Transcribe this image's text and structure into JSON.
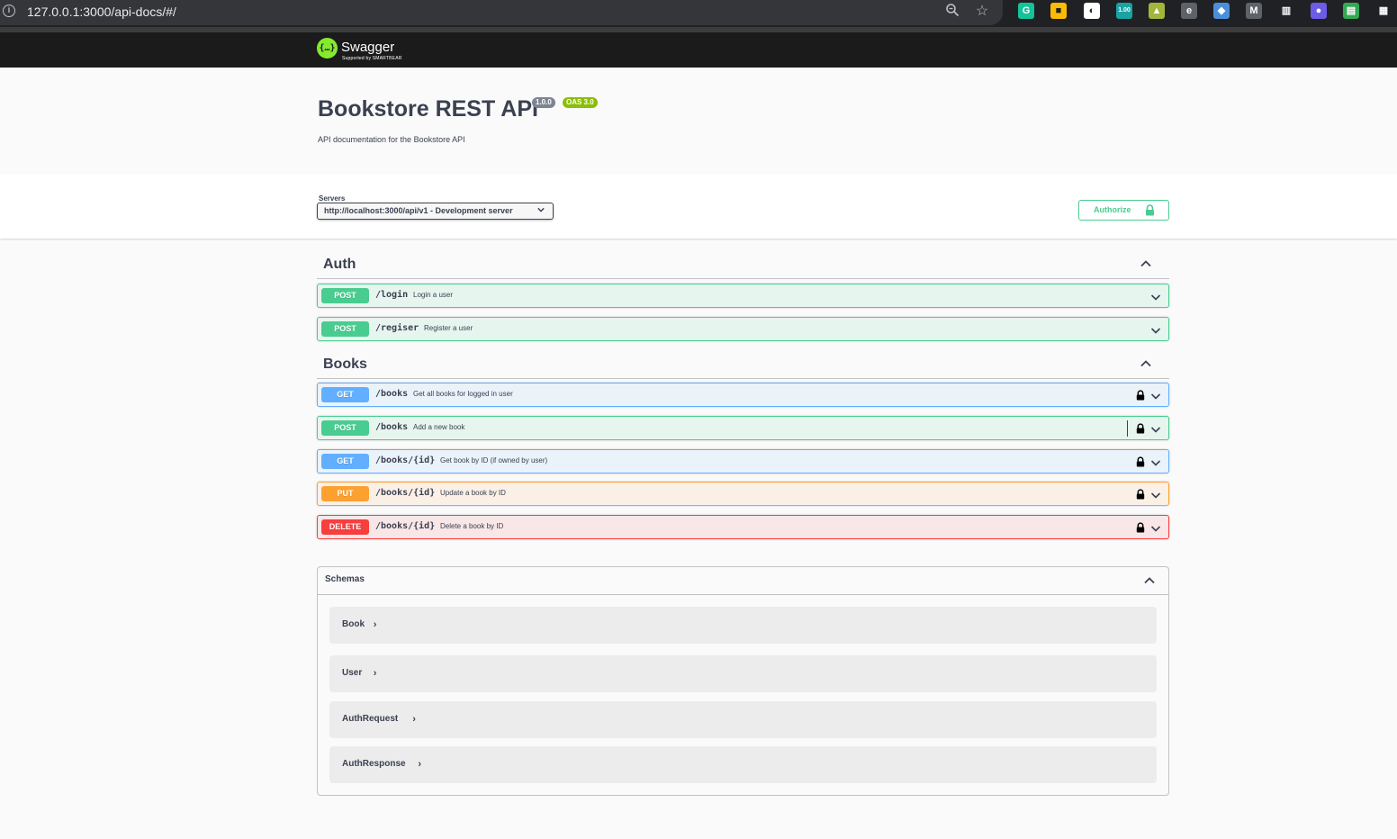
{
  "browser": {
    "url": "127.0.0.1:3000/api-docs/#/",
    "extensions": [
      {
        "name": "grammarly-icon",
        "label": "G",
        "color": "#15c39a"
      },
      {
        "name": "keep-icon",
        "label": "■",
        "color": "#fbbc04"
      },
      {
        "name": "circle-ext-icon",
        "label": "◐",
        "color": "#ffffff"
      },
      {
        "name": "counter-ext-icon",
        "label": "1.00",
        "color": "#1aa3a3"
      },
      {
        "name": "image-ext-icon",
        "label": "▲",
        "color": "#a3b63c"
      },
      {
        "name": "e-ext-icon",
        "label": "e",
        "color": "#5f6368"
      },
      {
        "name": "shield-ext-icon",
        "label": "◆",
        "color": "#4a90d9"
      },
      {
        "name": "m-ext-icon",
        "label": "M",
        "color": "#5f6368"
      },
      {
        "name": "columns-ext-icon",
        "label": "▥",
        "color": "#202124"
      },
      {
        "name": "robot-ext-icon",
        "label": "●",
        "color": "#6c5ce7"
      },
      {
        "name": "doc-ext-icon",
        "label": "▤",
        "color": "#34a853"
      },
      {
        "name": "qr-ext-icon",
        "label": "▦",
        "color": "#202124"
      }
    ]
  },
  "topbar": {
    "logo_text": "Swagger",
    "logo_sub": "Supported by SMARTBEAR",
    "logo_glyph": "{…}"
  },
  "info": {
    "title": "Bookstore REST API",
    "version": "1.0.0",
    "oas": "OAS 3.0",
    "description": "API documentation for the Bookstore API"
  },
  "servers": {
    "label": "Servers",
    "selected": "http://localhost:3000/api/v1 - Development server",
    "authorize_label": "Authorize"
  },
  "tags": [
    {
      "name": "Auth",
      "operations": [
        {
          "method": "POST",
          "path": "/login",
          "summary": "Login a user",
          "locked": false
        },
        {
          "method": "POST",
          "path": "/regiser",
          "summary": "Register a user",
          "locked": false
        }
      ]
    },
    {
      "name": "Books",
      "operations": [
        {
          "method": "GET",
          "path": "/books",
          "summary": "Get all books for logged in user",
          "locked": true
        },
        {
          "method": "POST",
          "path": "/books",
          "summary": "Add a new book",
          "locked": true
        },
        {
          "method": "GET",
          "path": "/books/{id}",
          "summary": "Get book by ID (if owned by user)",
          "locked": true
        },
        {
          "method": "PUT",
          "path": "/books/{id}",
          "summary": "Update a book by ID",
          "locked": true
        },
        {
          "method": "DELETE",
          "path": "/books/{id}",
          "summary": "Delete a book by ID",
          "locked": true
        }
      ]
    }
  ],
  "schemas": {
    "title": "Schemas",
    "models": [
      "Book",
      "User",
      "AuthRequest",
      "AuthResponse"
    ]
  }
}
